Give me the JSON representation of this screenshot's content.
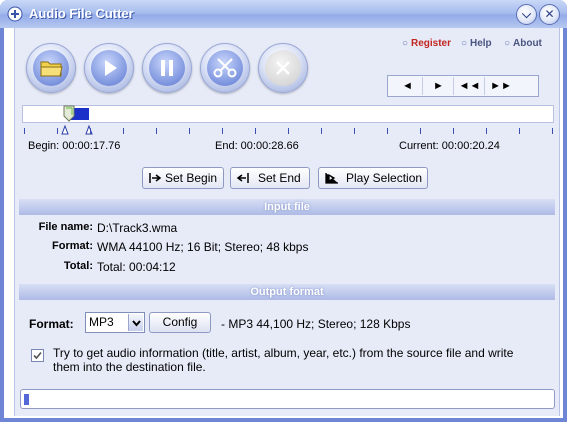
{
  "window": {
    "title": "Audio File Cutter",
    "minimize_glyph": "⌵",
    "close_glyph": "✕"
  },
  "toolbar": {
    "buttons": [
      {
        "name": "open",
        "icon": "folder-icon",
        "enabled": true
      },
      {
        "name": "play",
        "icon": "play-icon",
        "enabled": true
      },
      {
        "name": "pause",
        "icon": "pause-icon",
        "enabled": true
      },
      {
        "name": "cut",
        "icon": "scissors-icon",
        "enabled": true
      },
      {
        "name": "cancel",
        "icon": "close-icon",
        "enabled": false
      }
    ]
  },
  "links": {
    "bullet": "○",
    "register": "Register",
    "help": "Help",
    "about": "About"
  },
  "nav": {
    "buttons": [
      "◄",
      "►",
      "◄◄",
      "►►"
    ]
  },
  "timeline": {
    "begin_label": "Begin: 00:00:17.76",
    "end_label": "End: 00:00:28.66",
    "current_label": "Current: 00:00:20.24",
    "selection_start_fraction": 0.086,
    "selection_end_fraction": 0.124
  },
  "actions": {
    "set_begin": "Set Begin",
    "set_end": "Set End",
    "play_selection": "Play Selection"
  },
  "input_file": {
    "section_title": "Input file",
    "file_name_label": "File name:",
    "file_name": "D:\\Track3.wma",
    "format_label": "Format:",
    "format": "WMA 44100 Hz; 16 Bit; Stereo; 48 kbps",
    "total_label": "Total:",
    "total": "Total: 00:04:12"
  },
  "output_format": {
    "section_title": "Output format",
    "format_label": "Format:",
    "selected_format": "MP3",
    "config_label": "Config",
    "description": "- MP3 44,100 Hz; Stereo;  128 Kbps",
    "checkbox_checked": true,
    "checkbox_label": "Try to get audio information (title, artist, album, year, etc.) from the source file and write them into the destination file."
  },
  "progress": {
    "fraction": 0.01
  },
  "colors": {
    "title_gradient_top": "#c9d8f7",
    "panel_bg": "#e7ebf8",
    "selection": "#1a30c8",
    "register_link": "#c2251f"
  }
}
